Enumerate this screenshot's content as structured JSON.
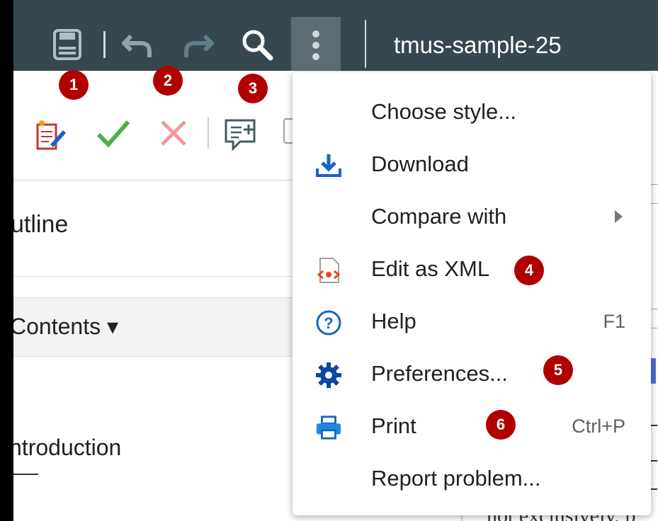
{
  "window": {
    "doc_title": "tmus-sample-25"
  },
  "toolbar": {
    "icons": [
      "save-icon",
      "undo-icon",
      "redo-icon",
      "search-icon",
      "more-vert-icon"
    ],
    "secondary_icons": [
      "edit-review-icon",
      "accept-change-icon",
      "reject-change-icon",
      "add-comment-icon"
    ]
  },
  "left_panel": {
    "outline_title": "utline",
    "contents_label": "Contents ▾",
    "item": "ntroduction"
  },
  "right_pane": {
    "bottom_text": "not exclusively, p"
  },
  "menu": {
    "items": [
      {
        "label": "Choose style...",
        "icon": "",
        "shortcut": ""
      },
      {
        "label": "Download",
        "icon": "download-icon",
        "shortcut": ""
      },
      {
        "label": "Compare with",
        "icon": "",
        "shortcut": "",
        "submenu": true
      },
      {
        "label": "Edit as XML",
        "icon": "xml-file-icon",
        "shortcut": ""
      },
      {
        "label": "Help",
        "icon": "help-icon",
        "shortcut": "F1"
      },
      {
        "label": "Preferences...",
        "icon": "gear-icon",
        "shortcut": ""
      },
      {
        "label": "Print",
        "icon": "print-icon",
        "shortcut": "Ctrl+P"
      },
      {
        "label": "Report problem...",
        "icon": "",
        "shortcut": ""
      }
    ]
  },
  "annotations": [
    "1",
    "2",
    "3",
    "4",
    "5",
    "6"
  ],
  "colors": {
    "topbar": "#37474f",
    "badge": "#b00000",
    "accent": "#1565c0",
    "accept": "#4caf50",
    "reject": "#e57373",
    "xml": "#e64a19"
  }
}
